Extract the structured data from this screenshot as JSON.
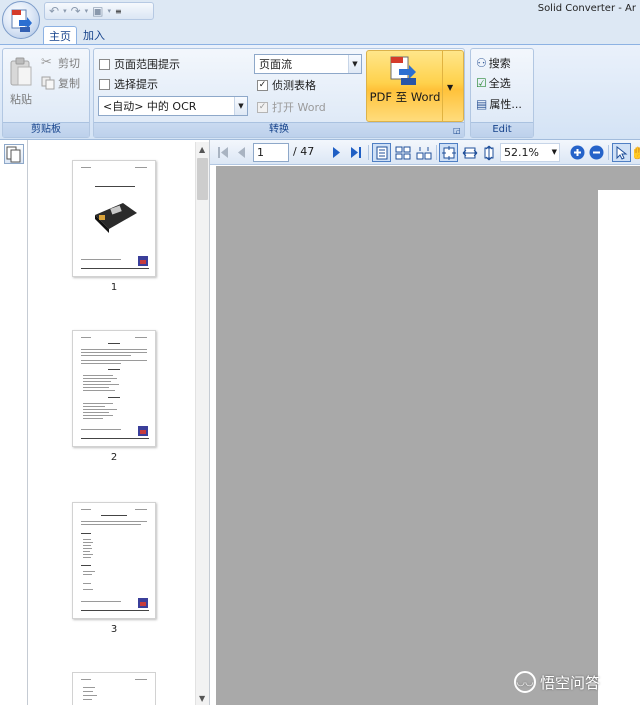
{
  "window": {
    "title": "Solid Converter - Ar"
  },
  "tabs": {
    "home": "主页",
    "addins": "加入"
  },
  "clipboard": {
    "paste": "粘贴",
    "cut": "剪切",
    "copy": "复制",
    "group_label": "剪贴板"
  },
  "convert": {
    "page_range_hint": "页面范围提示",
    "selection_hint": "选择提示",
    "ocr_select": "<自动> 中的 OCR",
    "layout_select": "页面流",
    "detect_tables": "侦测表格",
    "detect_tables_checked": true,
    "open_word": "打开 Word",
    "open_word_checked": true,
    "pdf_to_word": "PDF 至 Word",
    "group_label": "转换"
  },
  "edit": {
    "search": "搜索",
    "select_all": "全选",
    "properties": "属性...",
    "group_label": "Edit"
  },
  "viewer": {
    "current_page": "1",
    "total_pages": "/ 47",
    "zoom": "52.1%"
  },
  "thumbnails": [
    {
      "number": "1"
    },
    {
      "number": "2"
    },
    {
      "number": "3"
    }
  ],
  "watermark": {
    "text": "悟空问答"
  },
  "colors": {
    "ribbon_accent": "#15428b",
    "big_button": "#ffd24d",
    "doc_bg": "#a9a9a9"
  }
}
